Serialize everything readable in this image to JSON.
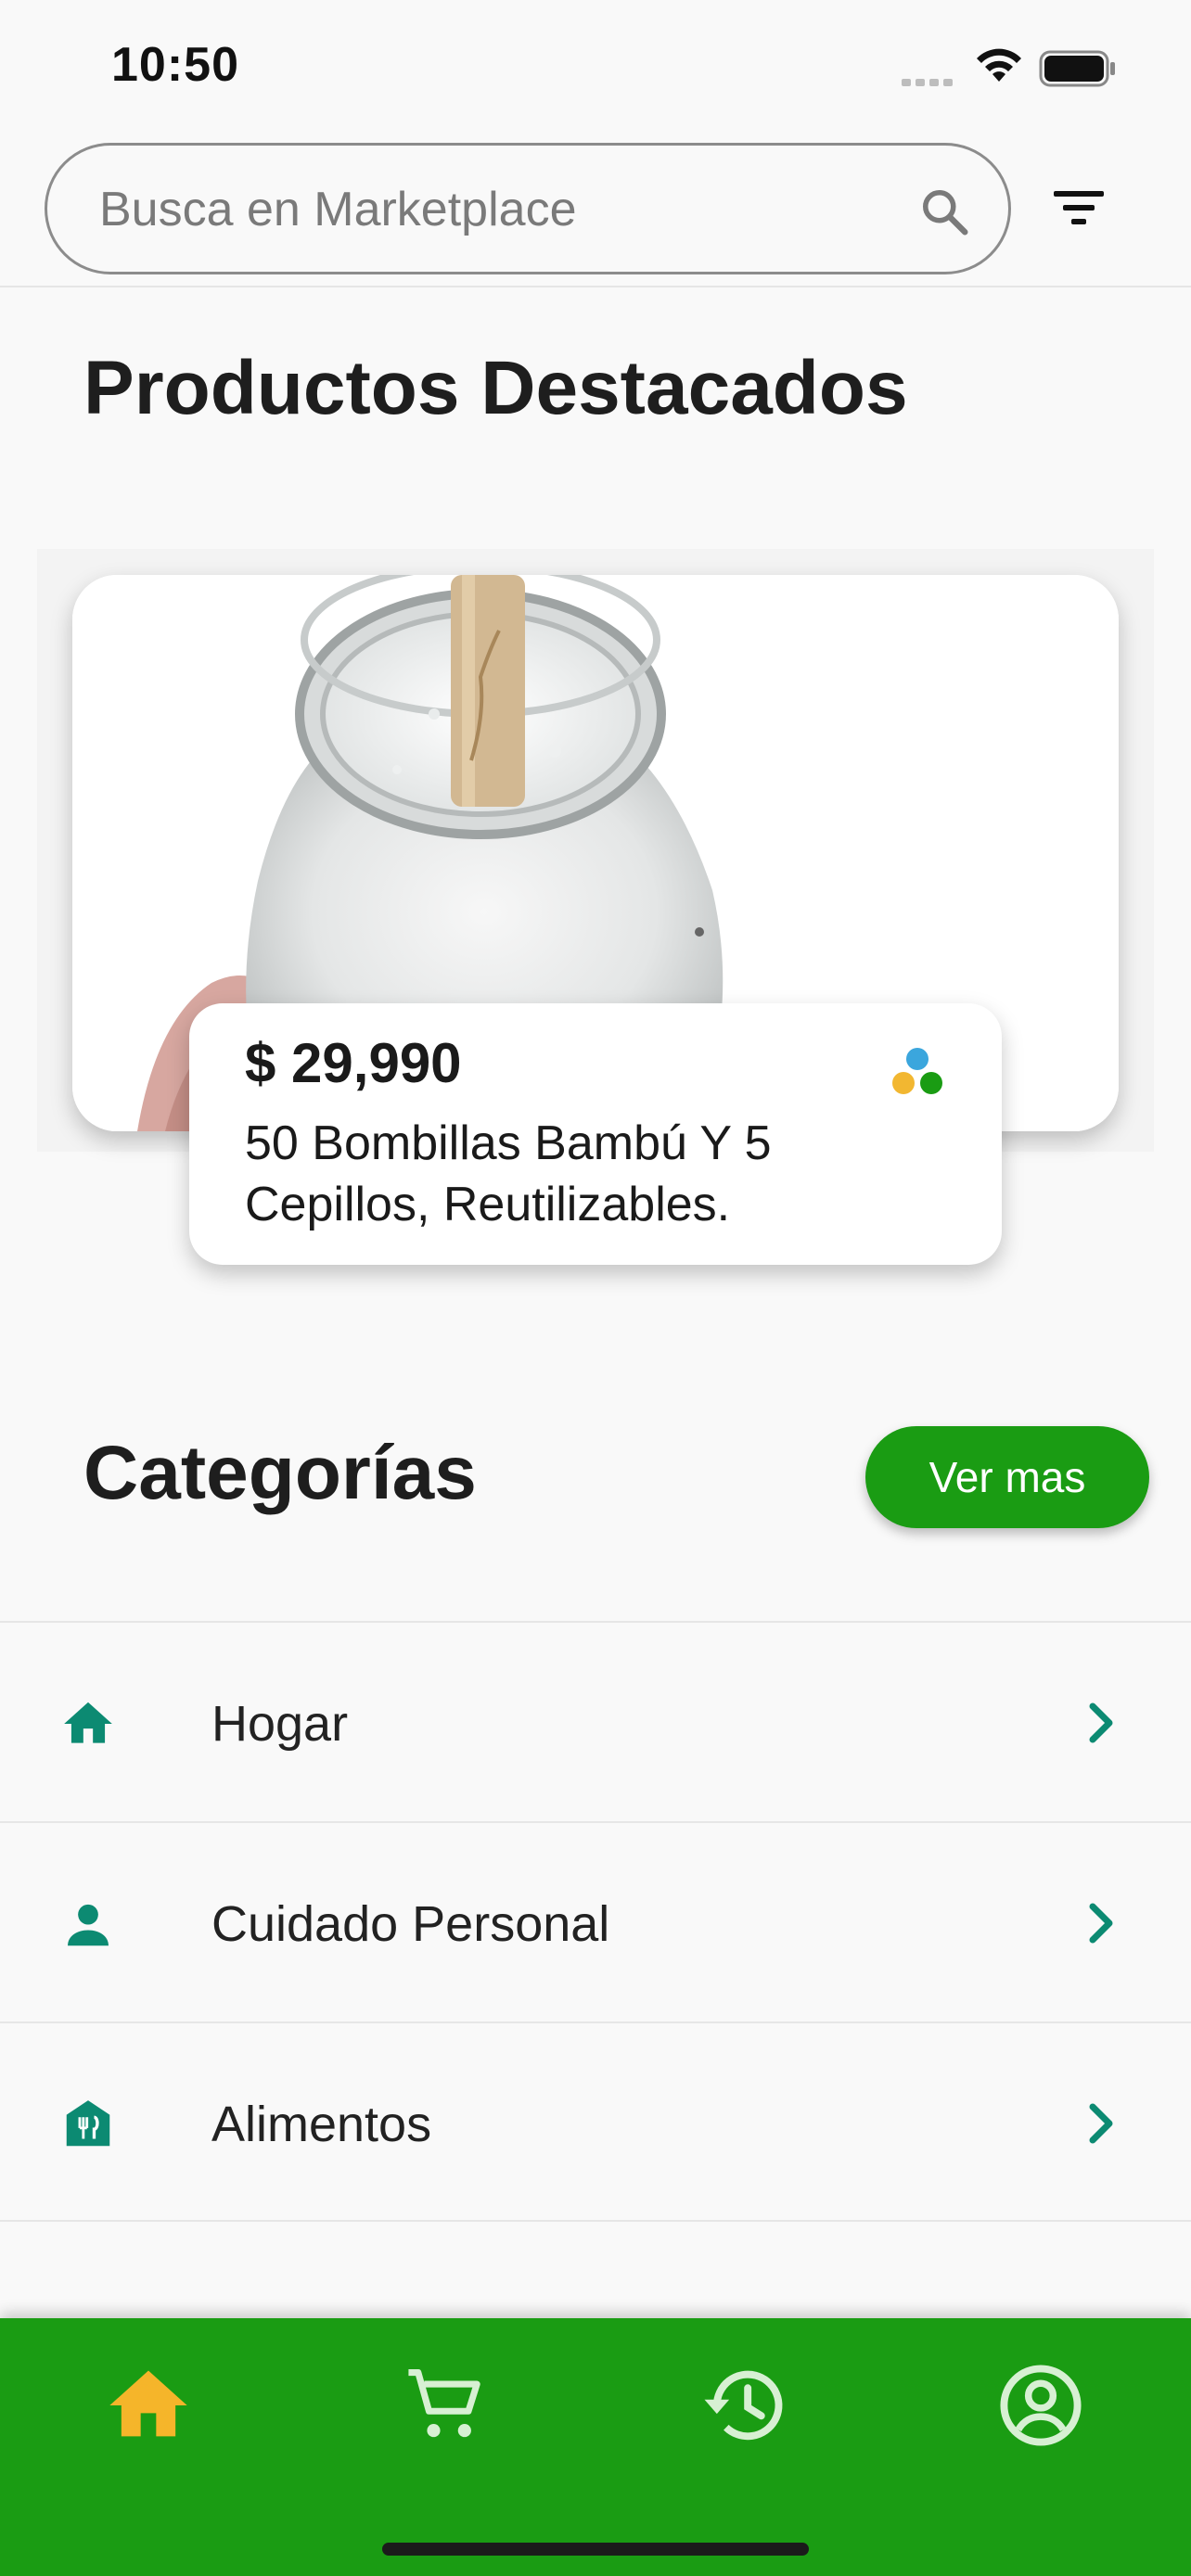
{
  "status_bar": {
    "time": "10:50"
  },
  "search": {
    "placeholder": "Busca en Marketplace"
  },
  "featured": {
    "title": "Productos Destacados",
    "product": {
      "price": "$ 29,990",
      "name": "50 Bombillas Bambú Y 5 Cepillos, Reutilizables."
    }
  },
  "categories": {
    "title": "Categorías",
    "ver_mas_label": "Ver mas",
    "items": [
      {
        "label": "Hogar",
        "icon": "home-icon"
      },
      {
        "label": "Cuidado Personal",
        "icon": "person-icon"
      },
      {
        "label": "Alimentos",
        "icon": "restaurant-icon"
      }
    ]
  },
  "bottom_nav": {
    "items": [
      {
        "icon": "home-icon",
        "active": true
      },
      {
        "icon": "cart-icon",
        "active": false
      },
      {
        "icon": "history-icon",
        "active": false
      },
      {
        "icon": "account-icon",
        "active": false
      }
    ]
  },
  "colors": {
    "accent_green": "#1a9c13",
    "icon_teal": "#0c8a72",
    "active_nav": "#f5b52a"
  }
}
